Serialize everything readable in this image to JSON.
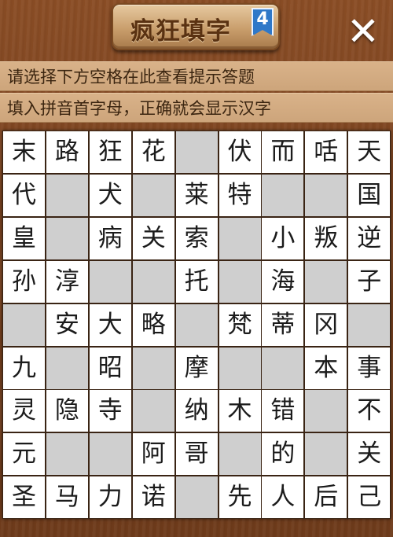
{
  "header": {
    "title": "疯狂填字",
    "level": "4",
    "close_label": "✕"
  },
  "hints": {
    "line1": "请选择下方空格在此查看提示答题",
    "line2": "填入拼音首字母，正确就会显示汉字"
  },
  "grid": [
    [
      "末",
      "路",
      "狂",
      "花",
      "",
      "伏",
      "而",
      "咶",
      "天"
    ],
    [
      "代",
      "",
      "犬",
      "",
      "莱",
      "特",
      "",
      "",
      "国"
    ],
    [
      "皇",
      "",
      "病",
      "关",
      "索",
      "",
      "小",
      "叛",
      "逆"
    ],
    [
      "孙",
      "淳",
      "",
      "",
      "托",
      "",
      "海",
      "",
      "子"
    ],
    [
      "",
      "安",
      "大",
      "略",
      "",
      "梵",
      "蒂",
      "冈",
      ""
    ],
    [
      "九",
      "",
      "昭",
      "",
      "摩",
      "",
      "",
      "本",
      "事"
    ],
    [
      "灵",
      "隐",
      "寺",
      "",
      "纳",
      "木",
      "错",
      "",
      "不"
    ],
    [
      "元",
      "",
      "",
      "阿",
      "哥",
      "",
      "的",
      "",
      "关"
    ],
    [
      "圣",
      "马",
      "力",
      "诺",
      "",
      "先",
      "人",
      "后",
      "己"
    ]
  ]
}
